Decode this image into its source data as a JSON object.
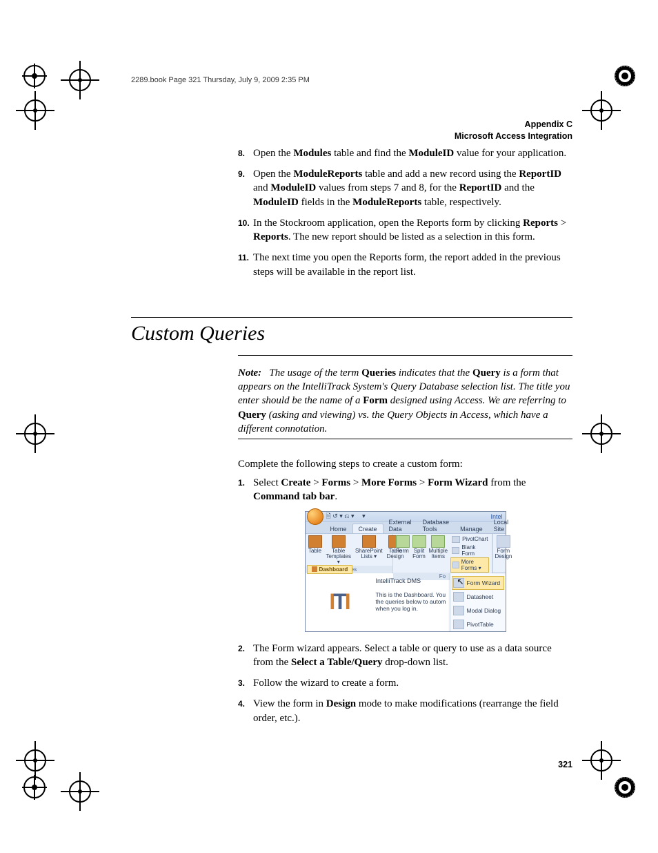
{
  "runhead": "2289.book  Page 321  Thursday, July 9, 2009  2:35 PM",
  "appendix_line1": "Appendix C",
  "appendix_line2": "Microsoft Access Integration",
  "steps_a": [
    {
      "n": "8.",
      "html": "Open the <b>Modules</b> table and find the <b>ModuleID</b> value for your application."
    },
    {
      "n": "9.",
      "html": "Open the <b>ModuleReports</b> table and add a new record using the <b>ReportID</b> and <b>ModuleID</b> values from steps 7 and 8, for the <b>ReportID</b> and the <b>ModuleID</b> fields in the <b>ModuleReports</b> table, respectively."
    },
    {
      "n": "10.",
      "html": "In the Stockroom application, open the Reports form by clicking <b>Reports</b> > <b>Reports</b>. The new report should be listed as a selection in this form."
    },
    {
      "n": "11.",
      "html": "The next time you open the Reports form, the report added in the previous steps will be available in the report list."
    }
  ],
  "section_title": "Custom Queries",
  "note_html": "<span class='lbl'>Note:</span>&nbsp;&nbsp; The usage of the term <span class='boldup'>Queries</span> indicates that the <span class='boldup'>Query</span> is a form that appears on the IntelliTrack System's Query Database selection list. The title you enter should be the name of a <span class='boldup'>Form</span> designed using Access. We are referring to <span class='boldup'>Query</span> (asking and viewing) vs. the Query Objects in Access, which have a different connotation.",
  "intro": "Complete the following steps to create a custom form:",
  "steps_b": [
    {
      "n": "1.",
      "html": "Select <b>Create</b> > <b>Forms</b> > <b>More Forms</b> > <b>Form Wizard</b> from the <b>Command tab bar</b>."
    }
  ],
  "steps_c": [
    {
      "n": "2.",
      "html": "The Form wizard appears. Select a table or query to use as a data source from the <b>Select a Table/Query</b> drop-down list."
    },
    {
      "n": "3.",
      "html": "Follow the wizard to create a form."
    },
    {
      "n": "4.",
      "html": "View the form in <b>Design</b> mode to make modifications (rearrange the field order, etc.)."
    }
  ],
  "page_number": "321",
  "fig": {
    "title_right": "Intel",
    "tabs": [
      "Home",
      "Create",
      "External Data",
      "Database Tools",
      "Manage",
      "Local Site"
    ],
    "active_tab": 1,
    "groups": {
      "tables": {
        "label": "Tables",
        "items": [
          "Table",
          "Table\nTemplates ▾",
          "SharePoint\nLists ▾",
          "Table\nDesign"
        ]
      },
      "forms": {
        "label": "Fo",
        "big": [
          "Form",
          "Split\nForm",
          "Multiple\nItems"
        ],
        "small": [
          "PivotChart",
          "Blank Form",
          "More Forms ▾"
        ],
        "right": "Form\nDesign"
      }
    },
    "dashboard_tab": "Dashboard",
    "mid_header": "IntelliTrack DMS",
    "mid_text": "This is the Dashboard. You the queries below to autom when you log in.",
    "menu": [
      "Form Wizard",
      "Datasheet",
      "Modal Dialog",
      "PivotTable"
    ],
    "menu_selected": 0
  }
}
